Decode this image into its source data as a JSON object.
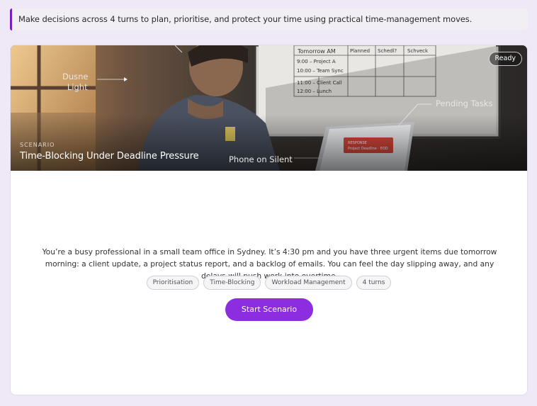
{
  "intro": {
    "text": "Make decisions across 4 turns to plan, prioritise, and protect your time using practical time-management moves."
  },
  "scenario": {
    "status_badge": "Ready",
    "eyebrow": "SCENARIO",
    "title": "Time-Blocking Under Deadline Pressure",
    "image_labels": {
      "light_line1": "Dusne",
      "light_line2": "Light",
      "pending": "Pending Tasks",
      "phone": "Phone on Silent"
    },
    "whiteboard": {
      "headers": [
        "Tomorrow AM",
        "Planned",
        "Schedl?",
        "Schveck"
      ],
      "rows": [
        "9:00 – Project A",
        "10:00 – Team Sync",
        "11:00 – Client Call",
        "12:00 – Lunch"
      ]
    },
    "laptop_alert": "RESPONSE\nProject Deadline · EOD",
    "description": "You’re a busy professional in a small team office in Sydney. It’s 4:30 pm and you have three urgent items due tomorrow morning: a client update, a project status report, and a backlog of emails. You can feel the day slipping away, and any delays will push work into overtime.",
    "tags": [
      "Prioritisation",
      "Time-Blocking",
      "Workload Management",
      "4 turns"
    ],
    "start_label": "Start Scenario"
  },
  "colors": {
    "accent": "#8c2ee0",
    "intro_border": "#7a1fc4",
    "page_bg": "#efe8f6"
  }
}
